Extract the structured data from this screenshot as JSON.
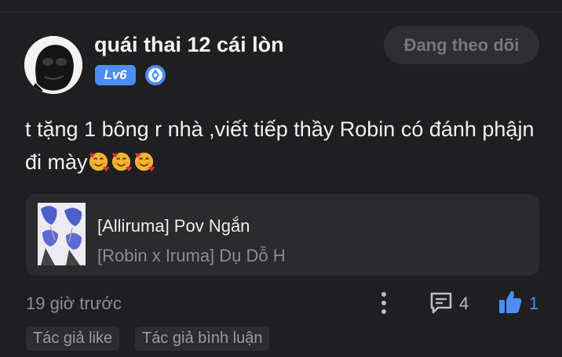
{
  "comment": {
    "username": "quái thai 12 cái lòn",
    "level": "Lv6",
    "follow_label": "Đang theo dõi",
    "text": "t tặng 1 bông r nhà ,viết tiếp thầy Robin có đánh phậjn đi mày",
    "emoji_count": 3,
    "story": {
      "title": "[Alliruma] Pov Ngắn",
      "subtitle": "[Robin x Iruma] Dụ Dỗ H"
    },
    "timestamp": "19 giờ trước",
    "comment_count": "4",
    "like_count": "1",
    "tags": [
      "Tác giả like",
      "Tác giả bình luận"
    ]
  },
  "colors": {
    "background": "#1f1f21",
    "accent": "#4c8df6",
    "card": "#2b2b2e",
    "muted_text": "#8e8e92"
  },
  "icons": [
    "avatar",
    "rank-icon",
    "emoji-heart-face",
    "more-vertical-icon",
    "comment-icon",
    "thumbs-up-icon"
  ]
}
